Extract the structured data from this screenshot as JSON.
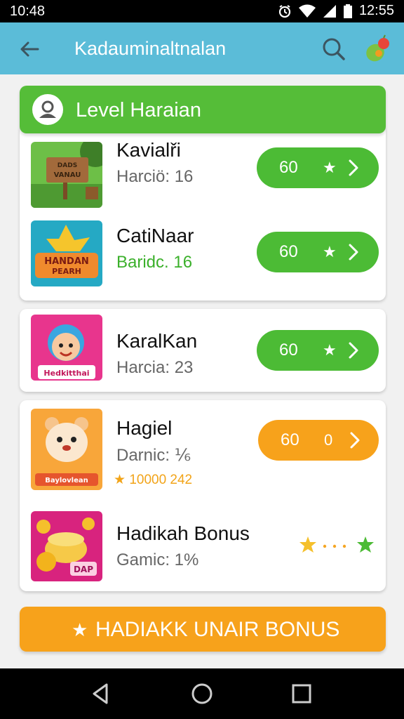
{
  "status_bar": {
    "time_left": "10:48",
    "time_right": "12:55",
    "icons": [
      "alarm-icon",
      "wifi-icon",
      "signal-icon",
      "battery-icon"
    ]
  },
  "app_bar": {
    "title": "Kadauminaltnalan",
    "icons": [
      "back-arrow-icon",
      "search-icon",
      "fruit-icon"
    ],
    "color": "#5bbcd8"
  },
  "level_banner": {
    "title": "Level Haraian",
    "icon": "avatar-icon",
    "color": "#55bd38"
  },
  "items": [
    {
      "name": "Kavialři",
      "subtitle": "Harciö: 16",
      "button_label": "60",
      "button_icon": "star-icon",
      "button_color": "#4cbb35",
      "thumb_text_1": "DADS",
      "thumb_text_2": "VANAU"
    },
    {
      "name": "CatiNaar",
      "subtitle": "Baridc. 16",
      "button_label": "60",
      "button_icon": "star-icon",
      "button_color": "#4cbb35",
      "thumb_text_1": "HANDAN",
      "thumb_text_2": "PEARH"
    },
    {
      "name": "KaralKan",
      "subtitle": "Harcia: 23",
      "button_label": "60",
      "button_icon": "star-icon",
      "button_color": "#4cbb35",
      "thumb_text_1": "Hedkitthai"
    },
    {
      "name": "Hagiel",
      "subtitle": "Darnic: ⅙",
      "extra": "10000 242",
      "button_label": "60",
      "button_icon_text": "0",
      "button_color": "#f7a21b",
      "thumb_text_1": "Baylovlean"
    },
    {
      "name": "Hadikah Bonus",
      "subtitle": "Gamic: 1%",
      "trailing_icons": [
        "star-icon",
        "dots-icon",
        "star-icon"
      ],
      "thumb_text_1": "DAP"
    }
  ],
  "cta": {
    "label": "HADIAKK UNAIR  BONUS",
    "icon": "star-icon",
    "color": "#f7a21b"
  },
  "nav_bar": {
    "icons": [
      "back-triangle-icon",
      "home-circle-icon",
      "recents-square-icon"
    ]
  }
}
